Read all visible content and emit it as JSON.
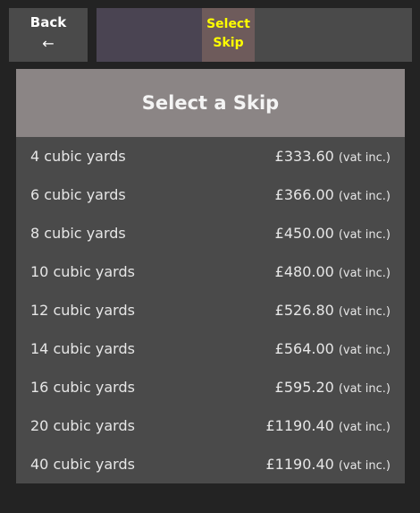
{
  "nav": {
    "back_label": "Back",
    "back_arrow": "←",
    "step_current_line1": "Select",
    "step_current_line2": "Skip"
  },
  "panel": {
    "title": "Select a Skip"
  },
  "skips": [
    {
      "size": "4 cubic yards",
      "price": "£333.60",
      "vat": "(vat inc.)"
    },
    {
      "size": "6 cubic yards",
      "price": "£366.00",
      "vat": "(vat inc.)"
    },
    {
      "size": "8 cubic yards",
      "price": "£450.00",
      "vat": "(vat inc.)"
    },
    {
      "size": "10 cubic yards",
      "price": "£480.00",
      "vat": "(vat inc.)"
    },
    {
      "size": "12 cubic yards",
      "price": "£526.80",
      "vat": "(vat inc.)"
    },
    {
      "size": "14 cubic yards",
      "price": "£564.00",
      "vat": "(vat inc.)"
    },
    {
      "size": "16 cubic yards",
      "price": "£595.20",
      "vat": "(vat inc.)"
    },
    {
      "size": "20 cubic yards",
      "price": "£1190.40",
      "vat": "(vat inc.)"
    },
    {
      "size": "40 cubic yards",
      "price": "£1190.40",
      "vat": "(vat inc.)"
    }
  ],
  "colors": {
    "current_step_text": "#ffff00",
    "current_step_bg": "#6e5b5b",
    "header_bg": "#8b8585"
  }
}
